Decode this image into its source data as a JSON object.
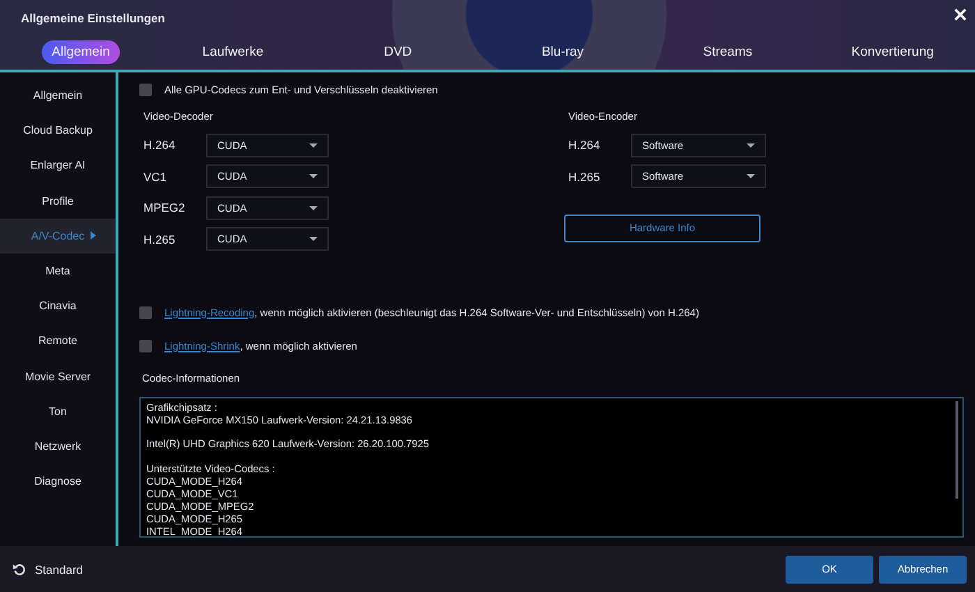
{
  "window": {
    "title": "Allgemeine Einstellungen"
  },
  "tabs": [
    {
      "label": "Allgemein",
      "selected": true
    },
    {
      "label": "Laufwerke",
      "selected": false
    },
    {
      "label": "DVD",
      "selected": false
    },
    {
      "label": "Blu-ray",
      "selected": false
    },
    {
      "label": "Streams",
      "selected": false
    },
    {
      "label": "Konvertierung",
      "selected": false
    }
  ],
  "sidebar": {
    "items": [
      {
        "label": "Allgemein",
        "selected": false
      },
      {
        "label": "Cloud Backup",
        "selected": false
      },
      {
        "label": "Enlarger AI",
        "selected": false
      },
      {
        "label": "Profile",
        "selected": false
      },
      {
        "label": "A/V-Codec",
        "selected": true
      },
      {
        "label": "Meta",
        "selected": false
      },
      {
        "label": "Cinavia",
        "selected": false
      },
      {
        "label": "Remote",
        "selected": false
      },
      {
        "label": "Movie Server",
        "selected": false
      },
      {
        "label": "Ton",
        "selected": false
      },
      {
        "label": "Netzwerk",
        "selected": false
      },
      {
        "label": "Diagnose",
        "selected": false
      }
    ]
  },
  "disable_gpu": {
    "label": "Alle GPU-Codecs zum Ent- und Verschlüsseln deaktivieren",
    "checked": false
  },
  "decoder": {
    "title": "Video-Decoder",
    "rows": [
      {
        "label": "H.264",
        "value": "CUDA"
      },
      {
        "label": "VC1",
        "value": "CUDA"
      },
      {
        "label": "MPEG2",
        "value": "CUDA"
      },
      {
        "label": "H.265",
        "value": "CUDA"
      }
    ]
  },
  "encoder": {
    "title": "Video-Encoder",
    "rows": [
      {
        "label": "H.264",
        "value": "Software"
      },
      {
        "label": "H.265",
        "value": "Software"
      }
    ]
  },
  "hardware_button": "Hardware Info",
  "options": [
    {
      "link": "Lightning-Recoding",
      "text": ", wenn möglich aktivieren (beschleunigt das H.264 Software-Ver- und Entschlüsseln) von H.264)",
      "checked": false
    },
    {
      "link": "Lightning-Shrink",
      "text": ", wenn möglich aktivieren",
      "checked": false
    }
  ],
  "codec_info": {
    "title": "Codec-Informationen",
    "paragraphs": [
      [
        "Grafikchipsatz :",
        "NVIDIA GeForce MX150 Laufwerk-Version: 24.21.13.9836"
      ],
      [
        "Intel(R) UHD Graphics 620 Laufwerk-Version: 26.20.100.7925"
      ],
      [
        "Unterstützte Video-Codecs :",
        "CUDA_MODE_H264",
        "CUDA_MODE_VC1",
        "CUDA_MODE_MPEG2",
        "CUDA_MODE_H265",
        "INTEL_MODE_H264"
      ]
    ]
  },
  "footer": {
    "reset": "Standard",
    "buttons": [
      "OK",
      "Abbrechen"
    ]
  }
}
